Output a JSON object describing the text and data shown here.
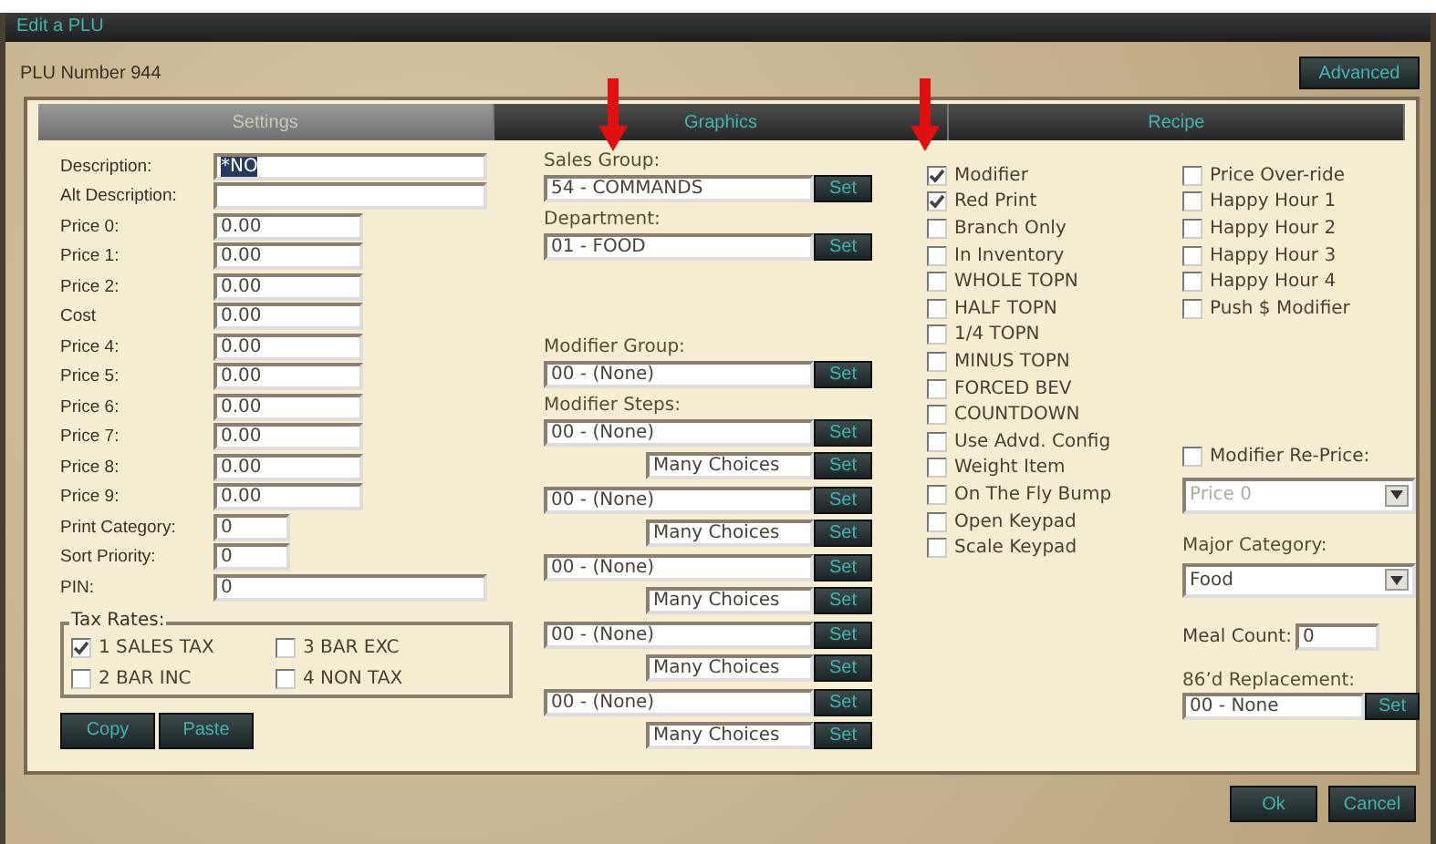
{
  "window": {
    "title": "Edit a PLU"
  },
  "header": {
    "plu_number": "PLU Number 944",
    "advanced_button": "Advanced"
  },
  "tabs": [
    {
      "label": "Settings",
      "selected": true
    },
    {
      "label": "Graphics",
      "selected": false
    },
    {
      "label": "Recipe",
      "selected": false
    }
  ],
  "fields": [
    {
      "label": "Description:",
      "value": "*NO",
      "text_selected": true,
      "kind": "long"
    },
    {
      "label": "Alt Description:",
      "kind": "long"
    },
    {
      "label": "Price 0:",
      "value": "0.00",
      "text_selected": false,
      "kind": "price"
    },
    {
      "label": "Price 1:",
      "value": "0.00",
      "text_selected": false,
      "kind": "price"
    },
    {
      "label": "Price 2:",
      "value": "0.00",
      "text_selected": false,
      "kind": "price"
    },
    {
      "label": "Cost",
      "value": "0.00",
      "text_selected": false,
      "kind": "price"
    },
    {
      "label": "Price 4:",
      "value": "0.00",
      "text_selected": false,
      "kind": "price"
    },
    {
      "label": "Price 5:",
      "value": "0.00",
      "text_selected": false,
      "kind": "price"
    },
    {
      "label": "Price 6:",
      "value": "0.00",
      "text_selected": false,
      "kind": "price"
    },
    {
      "label": "Price 7:",
      "value": "0.00",
      "text_selected": false,
      "kind": "price"
    },
    {
      "label": "Price 8:",
      "value": "0.00",
      "text_selected": false,
      "kind": "price"
    },
    {
      "label": "Price 9:",
      "value": "0.00",
      "text_selected": false,
      "kind": "price"
    },
    {
      "label": "Print Category:",
      "value": "0",
      "text_selected": false,
      "kind": "small"
    },
    {
      "label": "Sort Priority:",
      "value": "0",
      "text_selected": false,
      "kind": "small"
    },
    {
      "label": "PIN:",
      "value": "0",
      "text_selected": false,
      "kind": "long"
    }
  ],
  "tax_rates": {
    "title": "Tax Rates:",
    "items": [
      {
        "label": "1 SALES TAX",
        "checked": true
      },
      {
        "label": "3 BAR EXC",
        "checked": false
      },
      {
        "label": "2 BAR INC",
        "checked": false
      },
      {
        "label": "4 NON TAX",
        "checked": false
      }
    ]
  },
  "edit_buttons": [
    "Copy",
    "Paste"
  ],
  "sales_group": {
    "label": "Sales Group:",
    "value": "54 - COMMANDS",
    "button": "Set"
  },
  "department": {
    "label": "Department:",
    "value": "01 - FOOD",
    "button": "Set"
  },
  "modifier_group": {
    "label": "Modifier Group:",
    "value": "00 - (None)",
    "button": "Set"
  },
  "modifier_steps": {
    "label": "Modifier Steps:",
    "steps": [
      {
        "value": "00 - (None)",
        "button": "Set",
        "choices": "Many Choices",
        "choices_button": "Set"
      },
      {
        "value": "00 - (None)",
        "button": "Set",
        "choices": "Many Choices",
        "choices_button": "Set"
      },
      {
        "value": "00 - (None)",
        "button": "Set",
        "choices": "Many Choices",
        "choices_button": "Set"
      },
      {
        "value": "00 - (None)",
        "button": "Set",
        "choices": "Many Choices",
        "choices_button": "Set"
      },
      {
        "value": "00 - (None)",
        "button": "Set",
        "choices": "Many Choices",
        "choices_button": "Set"
      }
    ]
  },
  "options": [
    {
      "label": "Modifier",
      "checked": true
    },
    {
      "label": "Red Print",
      "checked": true
    },
    {
      "label": "Branch Only",
      "checked": false
    },
    {
      "label": "In Inventory",
      "checked": false
    },
    {
      "label": "WHOLE TOPN",
      "checked": false
    },
    {
      "label": "HALF TOPN",
      "checked": false
    },
    {
      "label": "1/4 TOPN",
      "checked": false
    },
    {
      "label": "MINUS TOPN",
      "checked": false
    },
    {
      "label": "FORCED BEV",
      "checked": false
    },
    {
      "label": "COUNTDOWN",
      "checked": false
    },
    {
      "label": "Use Advd. Config",
      "checked": false
    },
    {
      "label": "Weight Item",
      "checked": false
    },
    {
      "label": "On The Fly Bump",
      "checked": false
    },
    {
      "label": "Open Keypad",
      "checked": false
    },
    {
      "label": "Scale Keypad",
      "checked": false
    }
  ],
  "price_options": [
    {
      "label": "Price Over-ride",
      "checked": false
    },
    {
      "label": "Happy Hour 1",
      "checked": false
    },
    {
      "label": "Happy Hour 2",
      "checked": false
    },
    {
      "label": "Happy Hour 3",
      "checked": false
    },
    {
      "label": "Happy Hour 4",
      "checked": false
    },
    {
      "label": "Push $ Modifier",
      "checked": false
    }
  ],
  "modifier_reprice": {
    "label": "Modifier Re-Price:",
    "checked": false,
    "value": "Price 0",
    "disabled": true
  },
  "major_category": {
    "label": "Major Category:",
    "value": "Food"
  },
  "meal_count": {
    "label": "Meal Count:",
    "value": "0"
  },
  "replacement": {
    "label": "86’d Replacement:",
    "value": "00 - None",
    "button": "Set"
  },
  "footer_buttons": [
    "Ok",
    "Cancel"
  ]
}
